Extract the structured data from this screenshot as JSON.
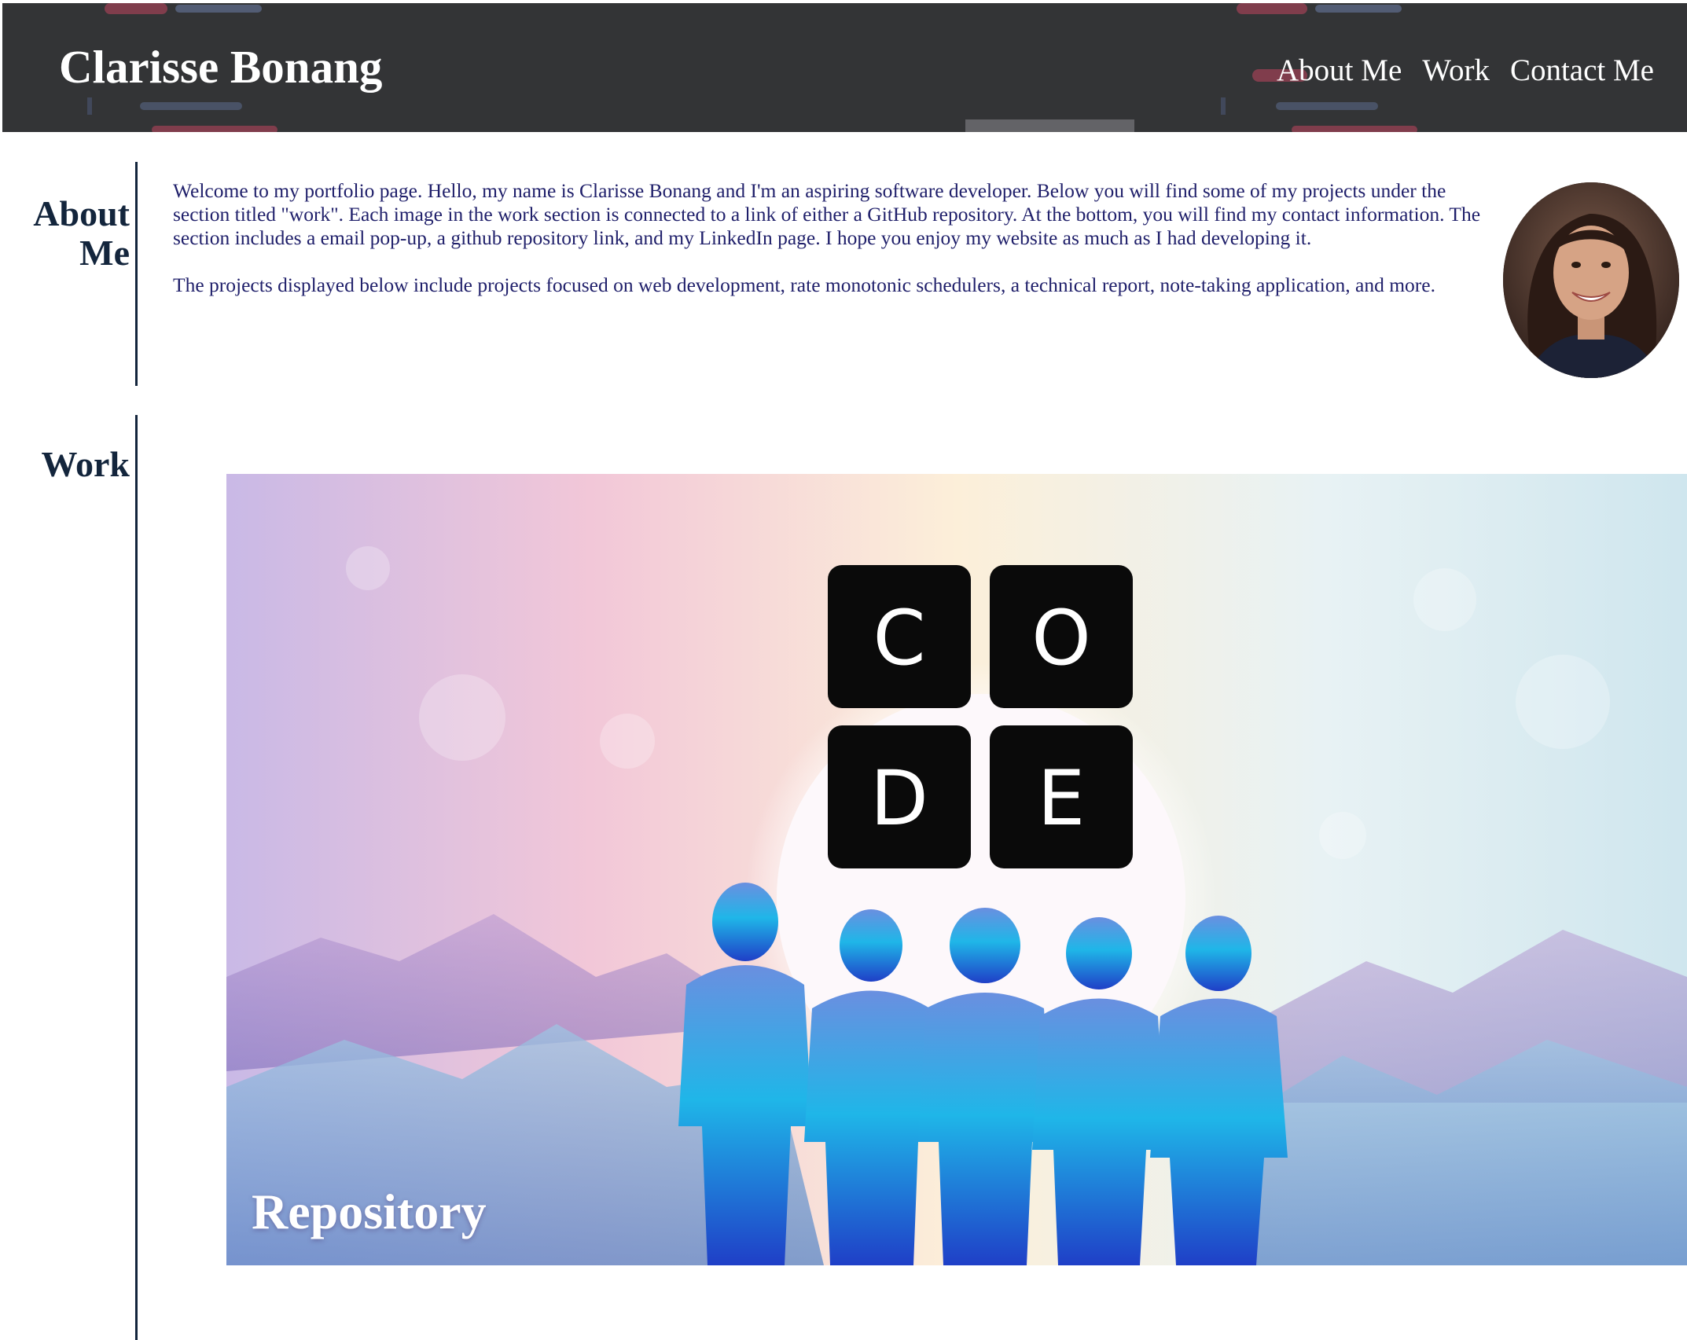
{
  "header": {
    "title": "Clarisse Bonang",
    "nav": [
      "About Me",
      "Work",
      "Contact Me"
    ]
  },
  "about": {
    "heading_line1": "About",
    "heading_line2": "Me",
    "paragraph1": "Welcome to my portfolio page. Hello, my name is Clarisse Bonang and I'm an aspiring software developer. Below you will find some of my projects under the section titled \"work\". Each image in the work section is connected to a link of either a GitHub repository. At the bottom, you will find my contact information. The section includes a email pop-up, a github repository link, and my LinkedIn page. I hope you enjoy my website as much as I had developing it.",
    "paragraph2": "The projects displayed below include projects focused on web development, rate monotonic schedulers, a technical report, note-taking application, and more."
  },
  "work": {
    "heading": "Work",
    "project": {
      "caption": "Repository",
      "logo_letters": [
        "C",
        "O",
        "D",
        "E"
      ]
    }
  },
  "colors": {
    "header_bg": "#333436",
    "heading": "#13253c",
    "body_text": "#1f1f6a"
  }
}
